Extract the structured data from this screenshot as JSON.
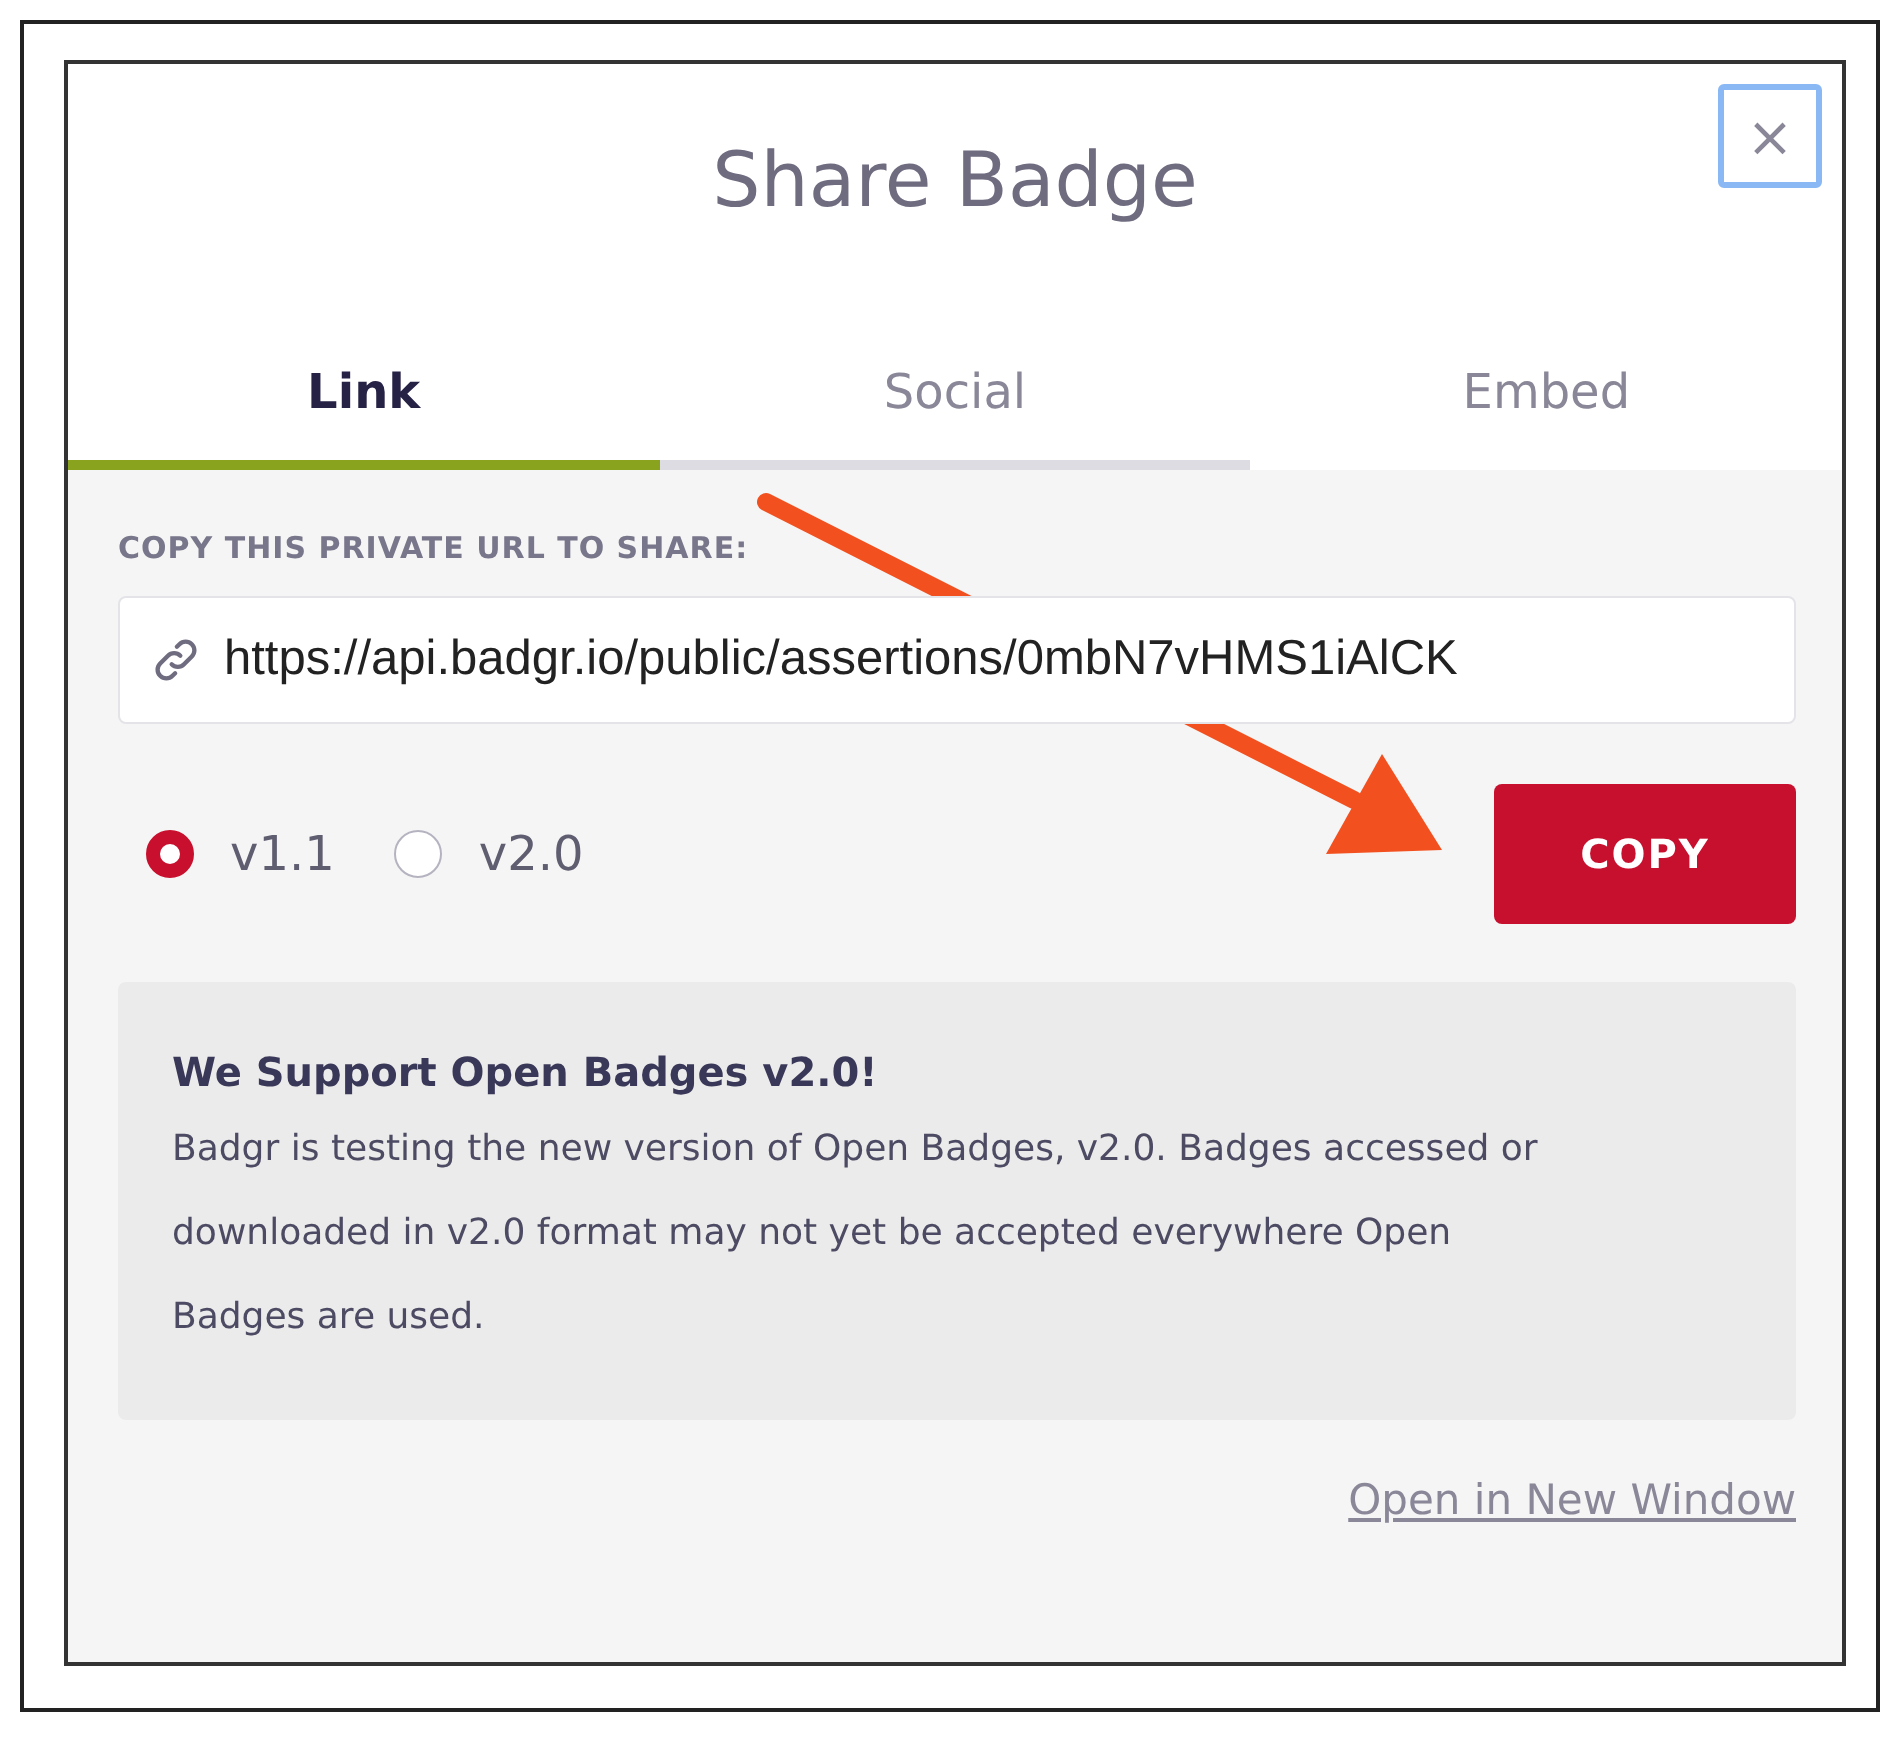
{
  "dialog": {
    "title": "Share Badge",
    "close": "×"
  },
  "tabs": [
    {
      "label": "Link",
      "selected": true
    },
    {
      "label": "Social",
      "selected": false
    },
    {
      "label": "Embed",
      "selected": false
    }
  ],
  "url_label": "COPY THIS PRIVATE URL TO SHARE:",
  "url_field": {
    "value": "https://api.badgr.io/public/assertions/0mbN7vHMS1iAlCK"
  },
  "versions": [
    {
      "label": "v1.1",
      "selected": true
    },
    {
      "label": "v2.0",
      "selected": false
    }
  ],
  "copy_button": "COPY",
  "notice": {
    "title": "We Support Open Badges v2.0!",
    "body": "Badgr is testing the new version of Open Badges, v2.0. Badges accessed or downloaded in v2.0 format may not yet be accepted everywhere Open Badges are used."
  },
  "open_link": "Open in New Window"
}
